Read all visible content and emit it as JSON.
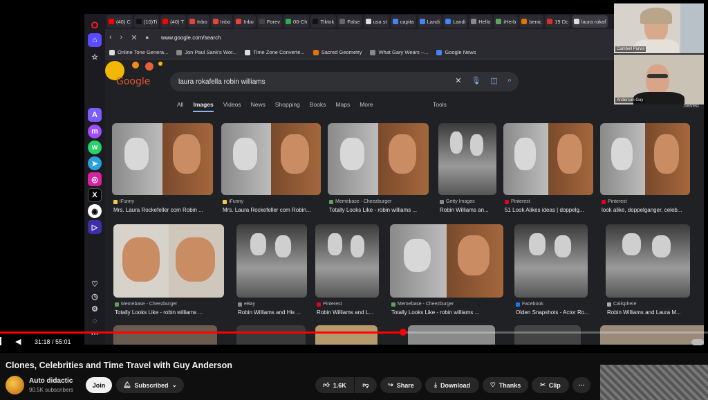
{
  "browser": {
    "tabs": [
      {
        "label": "(40) C",
        "color": "#ff0000"
      },
      {
        "label": "(10)Ti",
        "color": "#111111"
      },
      {
        "label": "(40) T",
        "color": "#ff0000"
      },
      {
        "label": "Inbo",
        "color": "#ea4335"
      },
      {
        "label": "Inbo",
        "color": "#ea4335"
      },
      {
        "label": "Inbo",
        "color": "#ea4335"
      },
      {
        "label": "Forev",
        "color": "#444444"
      },
      {
        "label": "00-Ch",
        "color": "#34a853"
      },
      {
        "label": "Tiktok",
        "color": "#111111"
      },
      {
        "label": "False",
        "color": "#666666"
      },
      {
        "label": "usa st",
        "color": "#dddddd"
      },
      {
        "label": "capita",
        "color": "#4285f4"
      },
      {
        "label": "Landi",
        "color": "#4285f4"
      },
      {
        "label": "Landi",
        "color": "#4285f4"
      },
      {
        "label": "Hello",
        "color": "#888888"
      },
      {
        "label": "iHerb",
        "color": "#58a55c"
      },
      {
        "label": "benic",
        "color": "#e37400"
      },
      {
        "label": "19 Dc",
        "color": "#d93025"
      },
      {
        "label": "laura rokaf",
        "color": "#dddddd"
      }
    ],
    "url": "www.google.com/search",
    "bookmarks": [
      {
        "label": "Online Tone Genera...",
        "color": "#dddddd"
      },
      {
        "label": "Jon Paul Sank's Wor...",
        "color": "#888888"
      },
      {
        "label": "Time Zone Converte...",
        "color": "#dddddd"
      },
      {
        "label": "Sacred Geometry",
        "color": "#e37400"
      },
      {
        "label": "What Gary Wears –...",
        "color": "#888888"
      },
      {
        "label": "Google News",
        "color": "#4285f4"
      }
    ]
  },
  "google": {
    "logo": "Google",
    "query": "laura rokafella robin williams",
    "tabs": [
      "All",
      "Images",
      "Videos",
      "News",
      "Shopping",
      "Books",
      "Maps",
      "More"
    ],
    "active_tab": "Images",
    "tools": "Tools",
    "saved": "Saved",
    "row1": [
      {
        "source": "iFunny",
        "title": "Mrs. Laura Rockefeller com Robin ...",
        "src_color": "#f7c948"
      },
      {
        "source": "iFunny",
        "title": "Mrs. Laura Rockefeller com Robin...",
        "src_color": "#f7c948"
      },
      {
        "source": "Memebase - Cheezburger",
        "title": "Totally Looks Like - robin williams ...",
        "src_color": "#58a55c"
      },
      {
        "source": "Getty Images",
        "title": "Robin Williams an...",
        "src_color": "#888888"
      },
      {
        "source": "Pinterest",
        "title": "51 Look Alikes ideas | doppelg...",
        "src_color": "#e60023"
      },
      {
        "source": "Pinterest",
        "title": "look alike, doppelganger, celeb...",
        "src_color": "#e60023"
      }
    ],
    "row2": [
      {
        "source": "Memebase - Cheezburger",
        "title": "Totally Looks Like - robin williams ...",
        "src_color": "#58a55c"
      },
      {
        "source": "eBay",
        "title": "Robin Williams and His ...",
        "src_color": "#888888"
      },
      {
        "source": "Pinterest",
        "title": "Robin Williams and L...",
        "src_color": "#e60023"
      },
      {
        "source": "Memebase - Cheezburger",
        "title": "Totally Looks Like - robin williams ...",
        "src_color": "#58a55c"
      },
      {
        "source": "Facebook",
        "title": "Olden Snapshots - Actor Ro...",
        "src_color": "#1877f2"
      },
      {
        "source": "Calisphere",
        "title": "Robin Williams and Laura M...",
        "src_color": "#aaaaaa"
      }
    ]
  },
  "player": {
    "time": "31:18 / 55:01",
    "progress": 0.569,
    "cams": [
      {
        "label": "Cambell Purvis"
      },
      {
        "label": "Anderson Guy"
      }
    ]
  },
  "video": {
    "title": "Clones, Celebrities and Time Travel with Guy Anderson",
    "channel": "Auto didactic",
    "subscribers": "90.5K subscribers",
    "join": "Join",
    "subscribed": "Subscribed",
    "likes": "1.6K",
    "share": "Share",
    "download": "Download",
    "thanks": "Thanks",
    "clip": "Clip"
  }
}
